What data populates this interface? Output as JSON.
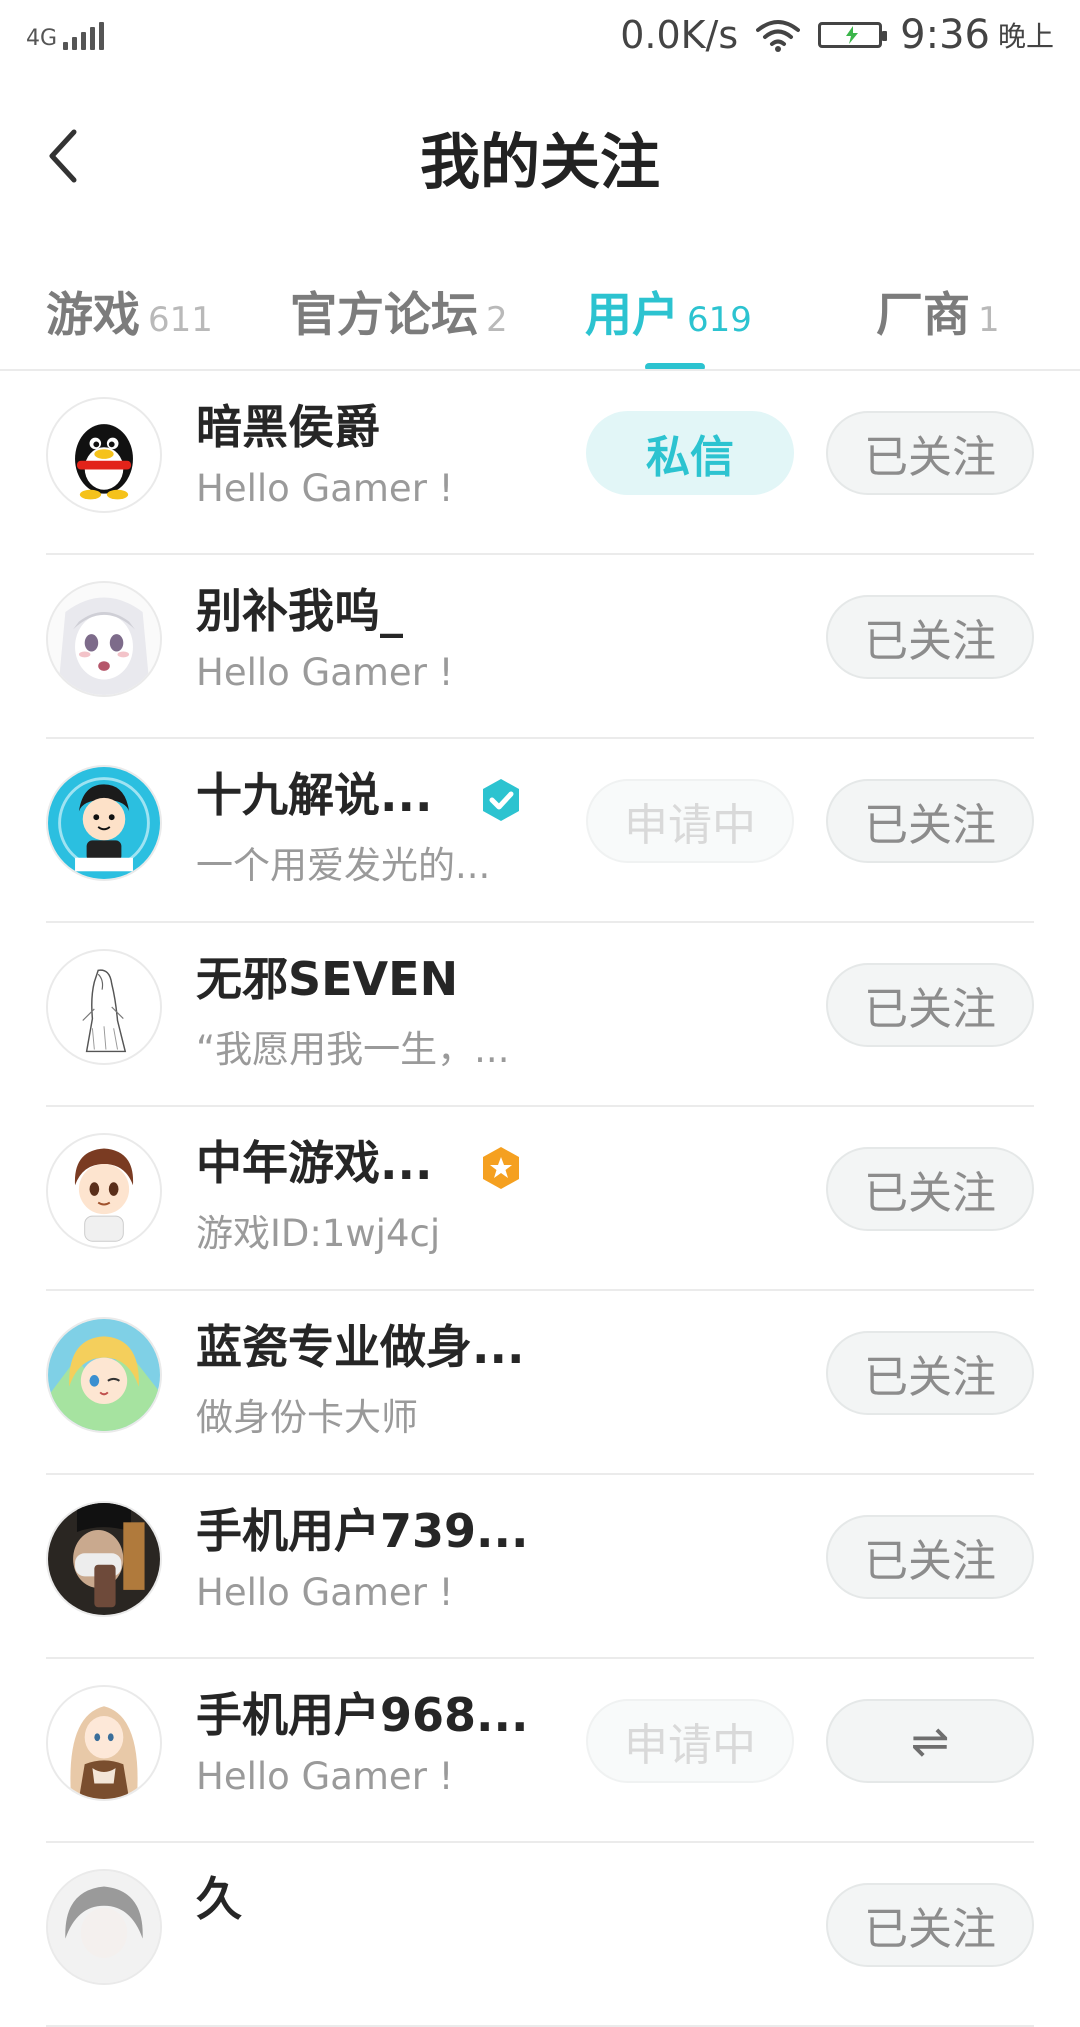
{
  "status_bar": {
    "network": "4G",
    "speed": "0.0K/s",
    "time": "9:36",
    "period": "晚上",
    "icons": [
      "signal-icon",
      "wifi-icon",
      "battery-icon"
    ]
  },
  "header": {
    "title": "我的关注",
    "back_icon": "back-chevron-icon"
  },
  "tabs": [
    {
      "label": "游戏",
      "count": "611",
      "active": false
    },
    {
      "label": "官方论坛",
      "count": "2",
      "active": false
    },
    {
      "label": "用户",
      "count": "619",
      "active": true
    },
    {
      "label": "厂商",
      "count": "1",
      "active": false
    }
  ],
  "users": [
    {
      "name": "暗黑侯爵",
      "bio": "Hello Gamer !",
      "avatar": "penguin-avatar",
      "message_button": "私信",
      "follow_button": "已关注"
    },
    {
      "name": "别补我呜_",
      "bio": "Hello Gamer !",
      "avatar": "anime-girl-avatar",
      "follow_button": "已关注"
    },
    {
      "name": "十九解说...",
      "bio": "一个用爱发光的...",
      "avatar": "cartoon-boy-avatar",
      "badge": "verified-check-icon",
      "pending_button": "申请中",
      "follow_button": "已关注"
    },
    {
      "name": "无邪SEVEN",
      "bio": "“我愿用我一生，...",
      "avatar": "sketch-figure-avatar",
      "follow_button": "已关注"
    },
    {
      "name": "中年游戏...",
      "bio": "游戏ID:1wj4cj",
      "avatar": "chibi-boy-avatar",
      "badge": "star-badge-icon",
      "follow_button": "已关注"
    },
    {
      "name": "蓝瓷专业做身...",
      "bio": "做身份卡大师",
      "avatar": "blonde-anime-avatar",
      "follow_button": "已关注"
    },
    {
      "name": "手机用户739...",
      "bio": "Hello Gamer !",
      "avatar": "photo-avatar",
      "follow_button": "已关注"
    },
    {
      "name": "手机用户968...",
      "bio": "Hello Gamer !",
      "avatar": "anime-woman-avatar",
      "pending_button": "申请中",
      "follow_button": "⇌"
    },
    {
      "name": "久",
      "bio": "",
      "avatar": "gray-anime-avatar",
      "follow_button": "已关注"
    }
  ],
  "colors": {
    "accent": "#2cc3d0",
    "verified": "#2cc3d0",
    "star_badge": "#f5a020"
  }
}
